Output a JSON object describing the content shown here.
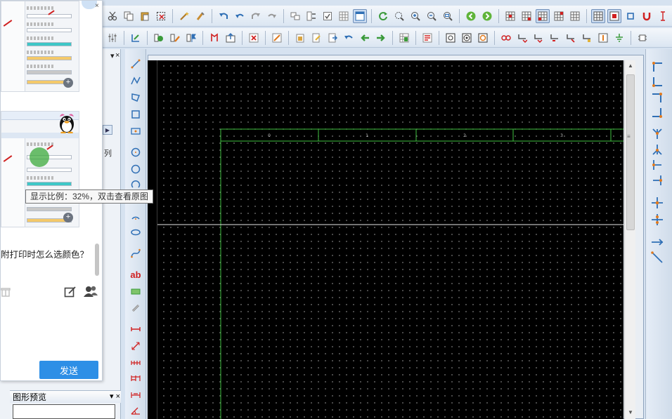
{
  "colors": {
    "canvas_bg": "#000000",
    "grid_dots": "#8a8a8a",
    "frame_lines": "#3fbf3f",
    "send_button": "#2d8fe6",
    "accent_orange": "#e07a1f",
    "accent_blue": "#2f6fb5"
  },
  "toolbar_top": {
    "icons": [
      "cut-icon",
      "copy-icon",
      "paste-icon",
      "select-icon",
      "wand-icon",
      "brush-icon",
      "undo-icon",
      "undo-alt-icon",
      "redo-icon",
      "redo-alt-icon",
      "group-icon",
      "swap-icon",
      "check-icon",
      "table-icon",
      "window-icon",
      "refresh-icon",
      "zoom-window-icon",
      "zoom-in-icon",
      "zoom-out-icon",
      "zoom-fit-icon",
      "nav-back-icon",
      "nav-forward-icon",
      "grid-a-icon",
      "grid-b-icon",
      "grid-c-icon",
      "grid-d-icon",
      "grid-e-icon",
      "snap-grid-icon",
      "snap-cross-icon",
      "crop-icon",
      "magnet-icon",
      "text-cursor-icon"
    ]
  },
  "toolbar_second": {
    "icons": [
      "tune-icon",
      "component-icon",
      "symbol-check-icon",
      "symbol-edit-icon",
      "flag-icon",
      "pin-icon",
      "upload-icon",
      "delete-icon",
      "cut-flag-icon",
      "paste-flag-icon",
      "doc-edit-icon",
      "export-icon",
      "undo-green-icon",
      "back-green-icon",
      "forward-green-icon",
      "table-edit-icon",
      "props-icon",
      "node-a-icon",
      "node-b-icon",
      "node-c-icon",
      "chain-icon",
      "route-a-icon",
      "route-b-icon",
      "route-c-icon",
      "route-d-icon",
      "route-e-icon",
      "route-f-icon",
      "ground-icon",
      "chip-icon"
    ]
  },
  "chat": {
    "tooltip": "显示比例：32%，双击查看原图",
    "message": "附打印时怎么选颜色？",
    "send_label": "发送"
  },
  "left_panel": {
    "tab_text": "列",
    "preview_title": "图形预览"
  },
  "vertical_tools": {
    "items": [
      "line-icon",
      "polyline-icon",
      "polygon-icon",
      "rectangle-icon",
      "insert-icon",
      "circle-icon",
      "circle-3pt-icon",
      "arc-icon",
      "arc-2-icon",
      "ellipse-icon",
      "bezier-icon",
      "text-ab-icon",
      "fill-icon",
      "chain-link-icon",
      "dimension-h-icon",
      "dimension-diag-icon",
      "dimension-chain-icon",
      "dimension-base-icon",
      "dimension-tol-icon",
      "dimension-angle-icon"
    ],
    "text_label": "ab"
  },
  "right_tools": {
    "items": [
      "corner-tl-icon",
      "corner-bl-icon",
      "corner-tr-icon",
      "corner-br-icon",
      "branch-a-icon",
      "branch-b-icon",
      "branch-c-icon",
      "branch-d-icon",
      "junction-a-icon",
      "junction-b-icon",
      "wire-arrow-icon",
      "wire-diag-icon"
    ]
  },
  "drawing": {
    "column_labels": [
      "0",
      "1",
      "2",
      "3"
    ]
  }
}
